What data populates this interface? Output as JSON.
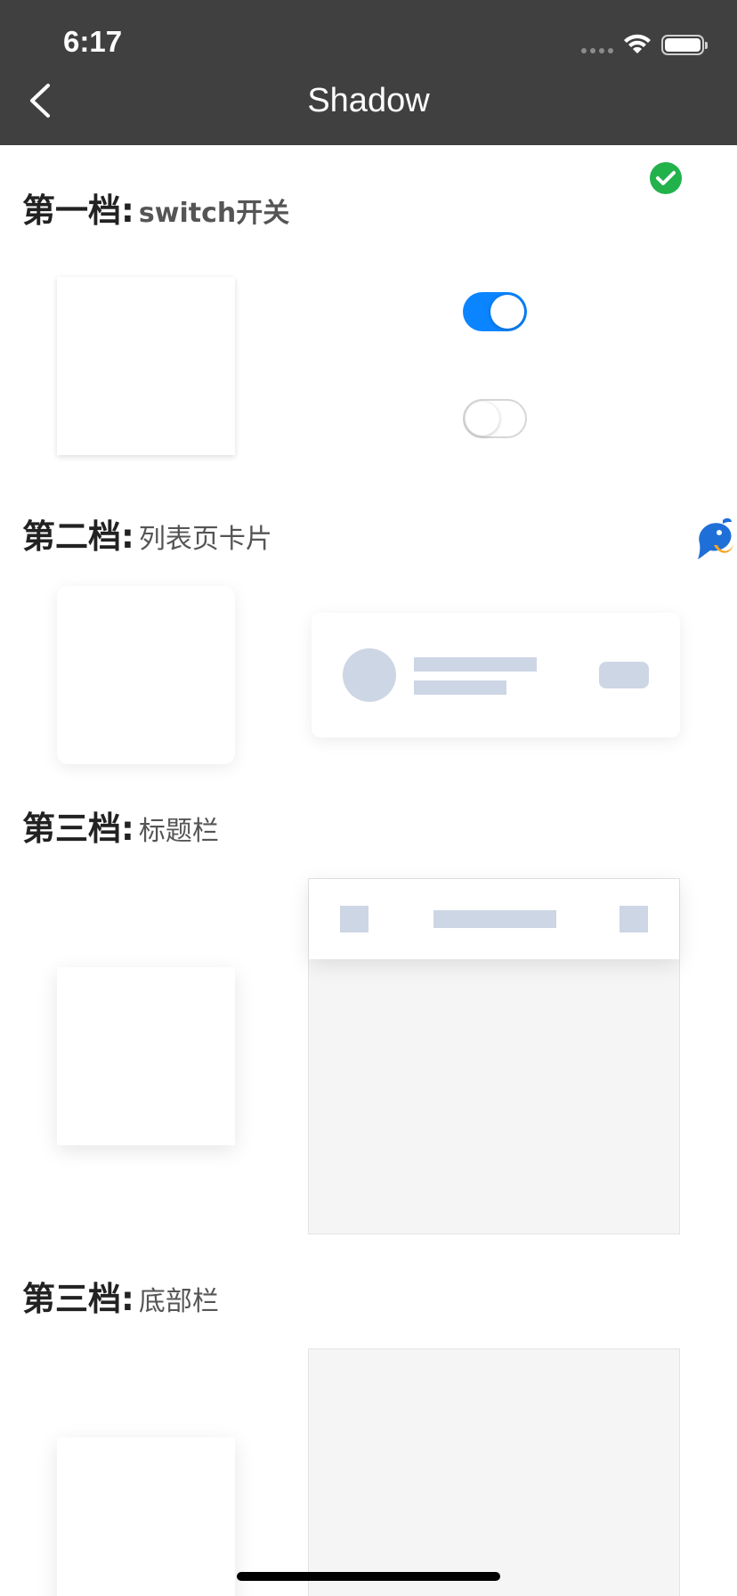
{
  "status_bar": {
    "time": "6:17"
  },
  "nav": {
    "title": "Shadow"
  },
  "sections": [
    {
      "level": "第一档:",
      "desc": "switch开关"
    },
    {
      "level": "第二档:",
      "desc": "列表页卡片"
    },
    {
      "level": "第三档:",
      "desc": "标题栏"
    },
    {
      "level": "第三档:",
      "desc": "底部栏"
    }
  ],
  "toggles": [
    {
      "state": "on"
    },
    {
      "state": "off"
    }
  ],
  "colors": {
    "header_bg": "#404040",
    "accent": "#0a84ff",
    "success": "#22b24c",
    "skeleton": "#cdd6e4"
  },
  "icons": [
    "back-arrow-icon",
    "checkmark-icon",
    "wifi-icon",
    "battery-icon",
    "dolphin-mascot-icon"
  ]
}
